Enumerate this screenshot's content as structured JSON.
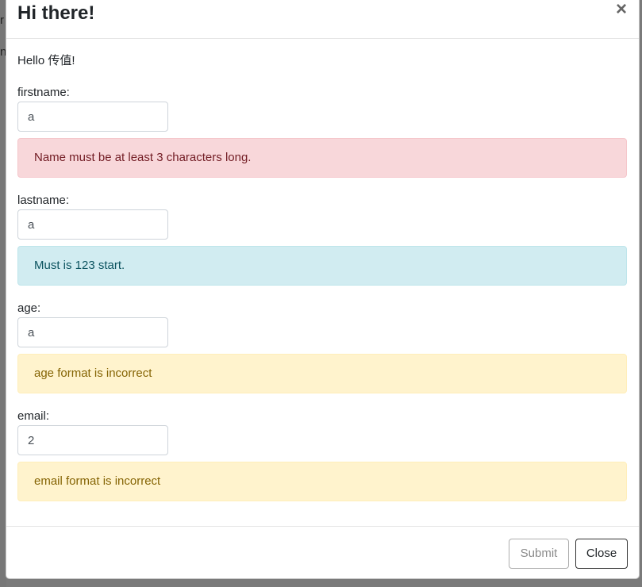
{
  "backdrop": {
    "fragments": [
      "r",
      "n"
    ]
  },
  "modal": {
    "title": "Hi there!",
    "close_symbol": "×",
    "greeting": "Hello 传值!"
  },
  "form": {
    "firstname": {
      "label": "firstname:",
      "value": "a",
      "message": "Name must be at least 3 characters long.",
      "message_type": "danger"
    },
    "lastname": {
      "label": "lastname:",
      "value": "a",
      "message": "Must is 123 start.",
      "message_type": "info"
    },
    "age": {
      "label": "age:",
      "value": "a",
      "message": "age format is incorrect",
      "message_type": "warning"
    },
    "email": {
      "label": "email:",
      "value": "2",
      "message": "email format is incorrect",
      "message_type": "warning"
    }
  },
  "footer": {
    "submit_label": "Submit",
    "close_label": "Close"
  },
  "colors": {
    "danger_bg": "#f8d7da",
    "info_bg": "#d1ecf1",
    "warning_bg": "#fff3cd"
  },
  "icons": {
    "close": "close-icon"
  }
}
